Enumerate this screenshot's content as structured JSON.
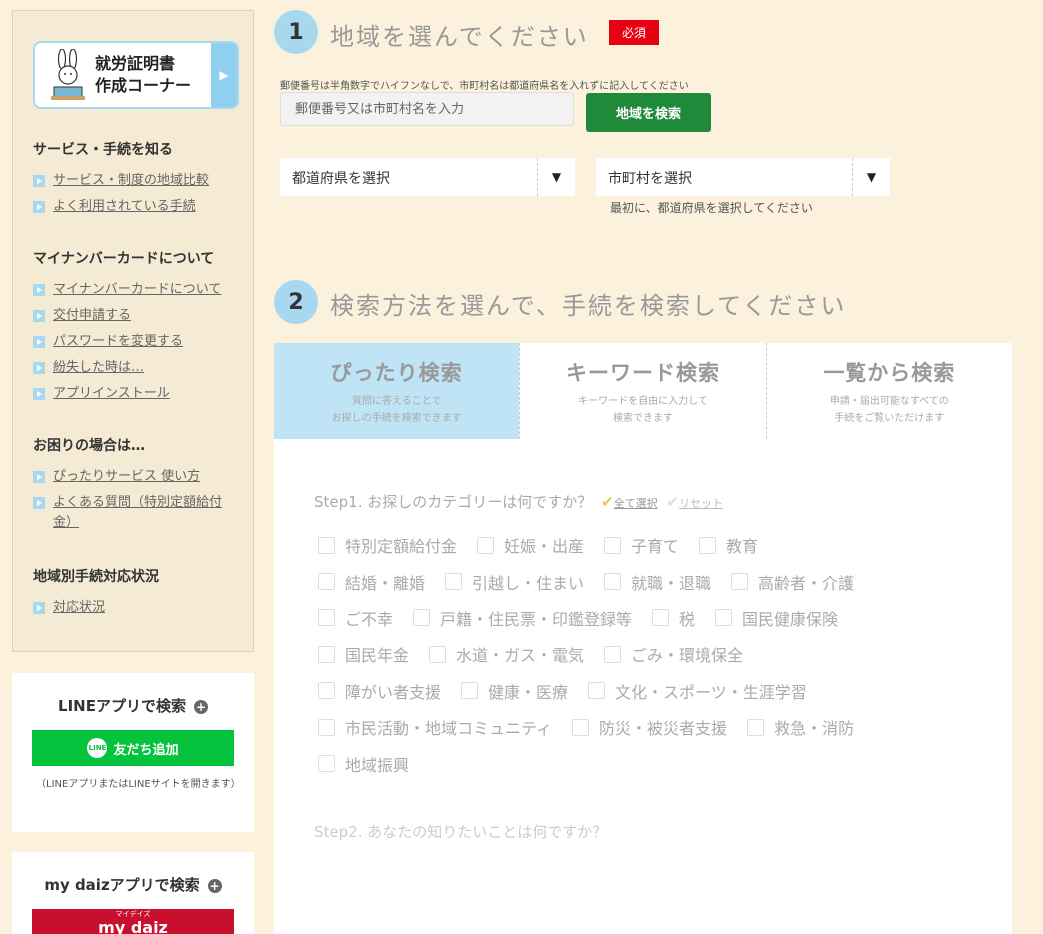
{
  "banner": {
    "line1": "就労証明書",
    "line2": "作成コーナー",
    "arrow": "▶"
  },
  "sidebar": {
    "sections": [
      {
        "heading": "サービス・手続を知る",
        "links": [
          "サービス・制度の地域比較",
          "よく利用されている手続"
        ]
      },
      {
        "heading": "マイナンバーカードについて",
        "links": [
          "マイナンバーカードについて",
          "交付申請する",
          "パスワードを変更する",
          "紛失した時は…",
          "アプリインストール"
        ]
      },
      {
        "heading": "お困りの場合は…",
        "links": [
          "ぴったりサービス 使い方",
          "よくある質問（特別定額給付金）"
        ]
      },
      {
        "heading": "地域別手続対応状況",
        "links": [
          "対応状況"
        ]
      }
    ]
  },
  "line_card": {
    "title": "LINEアプリで検索",
    "plus": "+",
    "badge": "LINE",
    "button": "友だち追加",
    "note": "（LINEアプリまたはLINEサイトを開きます）"
  },
  "daiz_card": {
    "title": "my daizアプリで検索",
    "plus": "+",
    "button_small": "マイデイズ",
    "button": "my daiz"
  },
  "step1": {
    "number": "1",
    "title": "地域を選んでください",
    "required": "必須",
    "hint": "郵便番号は半角数字でハイフンなしで、市町村名は都道府県名を入れずに記入してください",
    "input_placeholder": "郵便番号又は市町村名を入力",
    "search_button": "地域を検索",
    "pref_select": "都道府県を選択",
    "city_select": "市町村を選択",
    "arrow": "▼",
    "city_hint": "最初に、都道府県を選択してください"
  },
  "step2": {
    "number": "2",
    "title": "検索方法を選んで、手続を検索してください",
    "tabs": [
      {
        "title": "ぴったり検索",
        "desc1": "質問に答えることで",
        "desc2": "お探しの手続を検索できます"
      },
      {
        "title": "キーワード検索",
        "desc1": "キーワードを自由に入力して",
        "desc2": "検索できます"
      },
      {
        "title": "一覧から検索",
        "desc1": "申請・届出可能なすべての",
        "desc2": "手続をご覧いただけます"
      }
    ],
    "step1_prefix": "Step1.",
    "step1_question": "お探しのカテゴリーは何ですか？",
    "select_all": "全て選択",
    "reset": "リセット",
    "check": "✔",
    "categories": [
      [
        "特別定額給付金",
        "妊娠・出産",
        "子育て",
        "教育"
      ],
      [
        "結婚・離婚",
        "引越し・住まい",
        "就職・退職",
        "高齢者・介護"
      ],
      [
        "ご不幸",
        "戸籍・住民票・印鑑登録等",
        "税",
        "国民健康保険"
      ],
      [
        "国民年金",
        "水道・ガス・電気",
        "ごみ・環境保全"
      ],
      [
        "障がい者支援",
        "健康・医療",
        "文化・スポーツ・生涯学習"
      ],
      [
        "市民活動・地域コミュニティ",
        "防災・被災者支援",
        "救急・消防"
      ],
      [
        "地域振興"
      ]
    ],
    "step2_prefix": "Step2.",
    "step2_question": "あなたの知りたいことは何ですか？"
  }
}
